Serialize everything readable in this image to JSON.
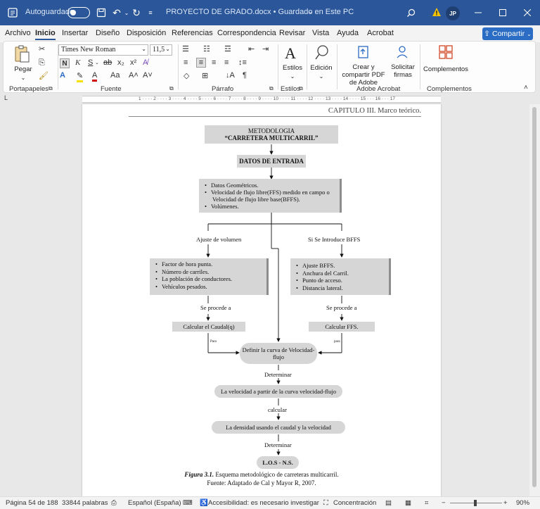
{
  "titlebar": {
    "autosave_label": "Autoguardado",
    "document_title": "PROYECTO DE GRADO.docx • Guardado en Este PC",
    "user_initials": "JP"
  },
  "menu": {
    "tabs": [
      "Archivo",
      "Inicio",
      "Insertar",
      "Diseño",
      "Disposición",
      "Referencias",
      "Correspondencia",
      "Revisar",
      "Vista",
      "Ayuda",
      "Acrobat"
    ],
    "active": "Inicio",
    "share_label": "Compartir"
  },
  "ribbon": {
    "clipboard": {
      "paste_label": "Pegar",
      "group_label": "Portapapeles"
    },
    "font": {
      "font_name": "Times New Roman",
      "font_size": "11,5",
      "group_label": "Fuente",
      "case_label": "Aa"
    },
    "paragraph": {
      "group_label": "Párrafo"
    },
    "styles": {
      "label": "Estilos",
      "group_label": "Estilos"
    },
    "editing": {
      "label": "Edición"
    },
    "acrobat": {
      "create_share_label": "Crear y compartir PDF de Adobe",
      "request_sign_label": "Solicitar firmas",
      "group_label": "Adobe Acrobat"
    },
    "addins": {
      "label": "Complementos",
      "group_label": "Complementos"
    }
  },
  "document": {
    "header_text": "CAPITULO III.  Marco teórico.",
    "flow": {
      "title_line1": "METODOLOGIA",
      "title_line2": "“CARRETERA MULTICARRIL”",
      "input_data": "DATOS DE ENTRADA",
      "input_items": [
        "Datos Geométricos.",
        "Velocidad de flujo libre(FFS) medido en campo o Velocidad de flujo libre base(BFFS).",
        "Volúmenes."
      ],
      "left_branch_label": "Ajuste de volumen",
      "right_branch_label": "Si Se Introduce BFFS",
      "left_items": [
        "Factor de hora punta.",
        "Número de carriles.",
        "La población de conductores.",
        "Vehículos pesados."
      ],
      "right_items": [
        "Ajuste BFFS.",
        "Anchura del Carril.",
        "Punto de acceso.",
        "Distancia lateral."
      ],
      "proceed_left": "Se procede a",
      "proceed_right": "Se procede a",
      "calc_flow": "Calcular el Caudal(q)",
      "calc_ffs": "Calcular FFS.",
      "para_left": "Para",
      "para_right": "para",
      "define_curve": "Definir la curva de Velocidad-flujo",
      "determine_1": "Determinar",
      "speed_from_curve": "La velocidad a partir de la curva velocidad-flujo",
      "calculate": "calcular",
      "density": "La densidad usando el caudal y la velocidad",
      "determine_2": "Determinar",
      "los": "L.O.S - N.S."
    },
    "caption_fig": "Figura 3.1.",
    "caption_text": " Esquema metodológico de carreteras multicarril.",
    "caption_source": "Fuente: Adaptado de Cal y Mayor R, 2007."
  },
  "statusbar": {
    "page": "Página 54 de 188",
    "words": "33844 palabras",
    "language": "Español (España)",
    "accessibility": "Accesibilidad: es necesario investigar",
    "focus": "Concentración",
    "zoom": "90%"
  }
}
